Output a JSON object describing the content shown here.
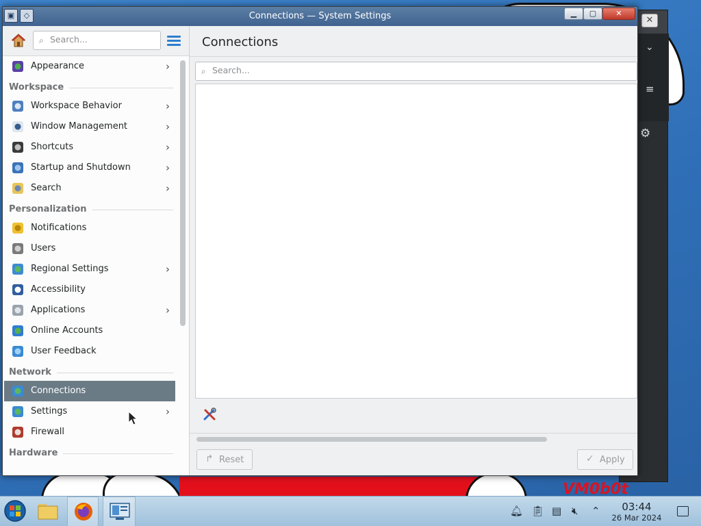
{
  "window": {
    "title": "Connections — System Settings"
  },
  "sidebar": {
    "search_placeholder": "Search...",
    "items": [
      {
        "kind": "item",
        "label": "Appearance",
        "icon": "appearance-icon",
        "chevron": true
      },
      {
        "kind": "header",
        "label": "Workspace"
      },
      {
        "kind": "item",
        "label": "Workspace Behavior",
        "icon": "workspace-behavior-icon",
        "chevron": true
      },
      {
        "kind": "item",
        "label": "Window Management",
        "icon": "window-management-icon",
        "chevron": true
      },
      {
        "kind": "item",
        "label": "Shortcuts",
        "icon": "keyboard-icon",
        "chevron": true
      },
      {
        "kind": "item",
        "label": "Startup and Shutdown",
        "icon": "startup-icon",
        "chevron": true
      },
      {
        "kind": "item",
        "label": "Search",
        "icon": "search-settings-icon",
        "chevron": true
      },
      {
        "kind": "header",
        "label": "Personalization"
      },
      {
        "kind": "item",
        "label": "Notifications",
        "icon": "bell-icon",
        "chevron": false
      },
      {
        "kind": "item",
        "label": "Users",
        "icon": "users-icon",
        "chevron": false
      },
      {
        "kind": "item",
        "label": "Regional Settings",
        "icon": "globe-icon",
        "chevron": true
      },
      {
        "kind": "item",
        "label": "Accessibility",
        "icon": "accessibility-icon",
        "chevron": false
      },
      {
        "kind": "item",
        "label": "Applications",
        "icon": "applications-icon",
        "chevron": true
      },
      {
        "kind": "item",
        "label": "Online Accounts",
        "icon": "online-accounts-icon",
        "chevron": false
      },
      {
        "kind": "item",
        "label": "User Feedback",
        "icon": "feedback-icon",
        "chevron": false
      },
      {
        "kind": "header",
        "label": "Network"
      },
      {
        "kind": "item",
        "label": "Connections",
        "icon": "connections-icon",
        "chevron": false,
        "active": true
      },
      {
        "kind": "item",
        "label": "Settings",
        "icon": "network-settings-icon",
        "chevron": true
      },
      {
        "kind": "item",
        "label": "Firewall",
        "icon": "firewall-icon",
        "chevron": false
      },
      {
        "kind": "header",
        "label": "Hardware"
      }
    ]
  },
  "content": {
    "title": "Connections",
    "search_placeholder": "Search...",
    "reset_label": "Reset",
    "apply_label": "Apply"
  },
  "taskbar": {
    "time": "03:44",
    "date": "26 Mar 2024"
  },
  "wallpaper": {
    "watermark": "VM0b0t"
  },
  "colors": {
    "titlebar": "#4a6d96",
    "active_item": "#6b7b86",
    "accent": "#2d7fcf"
  }
}
